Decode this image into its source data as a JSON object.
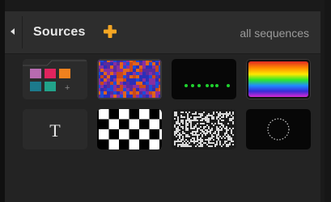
{
  "header": {
    "title": "Sources",
    "add_label": "+",
    "filter_label": "all sequences"
  },
  "sources": [
    {
      "name": "Color Grid",
      "icon": "color-grid-icon"
    },
    {
      "name": "Mosaic Pattern",
      "icon": "mosaic-pattern-icon"
    },
    {
      "name": "Dot Sequence",
      "icon": "dot-sequence-icon"
    },
    {
      "name": "Rainbow Gradient",
      "icon": "rainbow-gradient-icon"
    },
    {
      "name": "Text",
      "icon": "text-icon",
      "glyph": "T"
    },
    {
      "name": "Checkerboard",
      "icon": "checkerboard-icon"
    },
    {
      "name": "Noise",
      "icon": "noise-icon"
    },
    {
      "name": "Circle",
      "icon": "circle-icon"
    }
  ],
  "colors": {
    "accent": "#f5a623",
    "panel": "#232323",
    "header": "#2d2d2d",
    "grid_swatches": [
      "#b76bb0",
      "#e0245e",
      "#f0811e",
      "#1c7a8c",
      "#22a38a"
    ],
    "dot_green": "#1fd12e"
  }
}
